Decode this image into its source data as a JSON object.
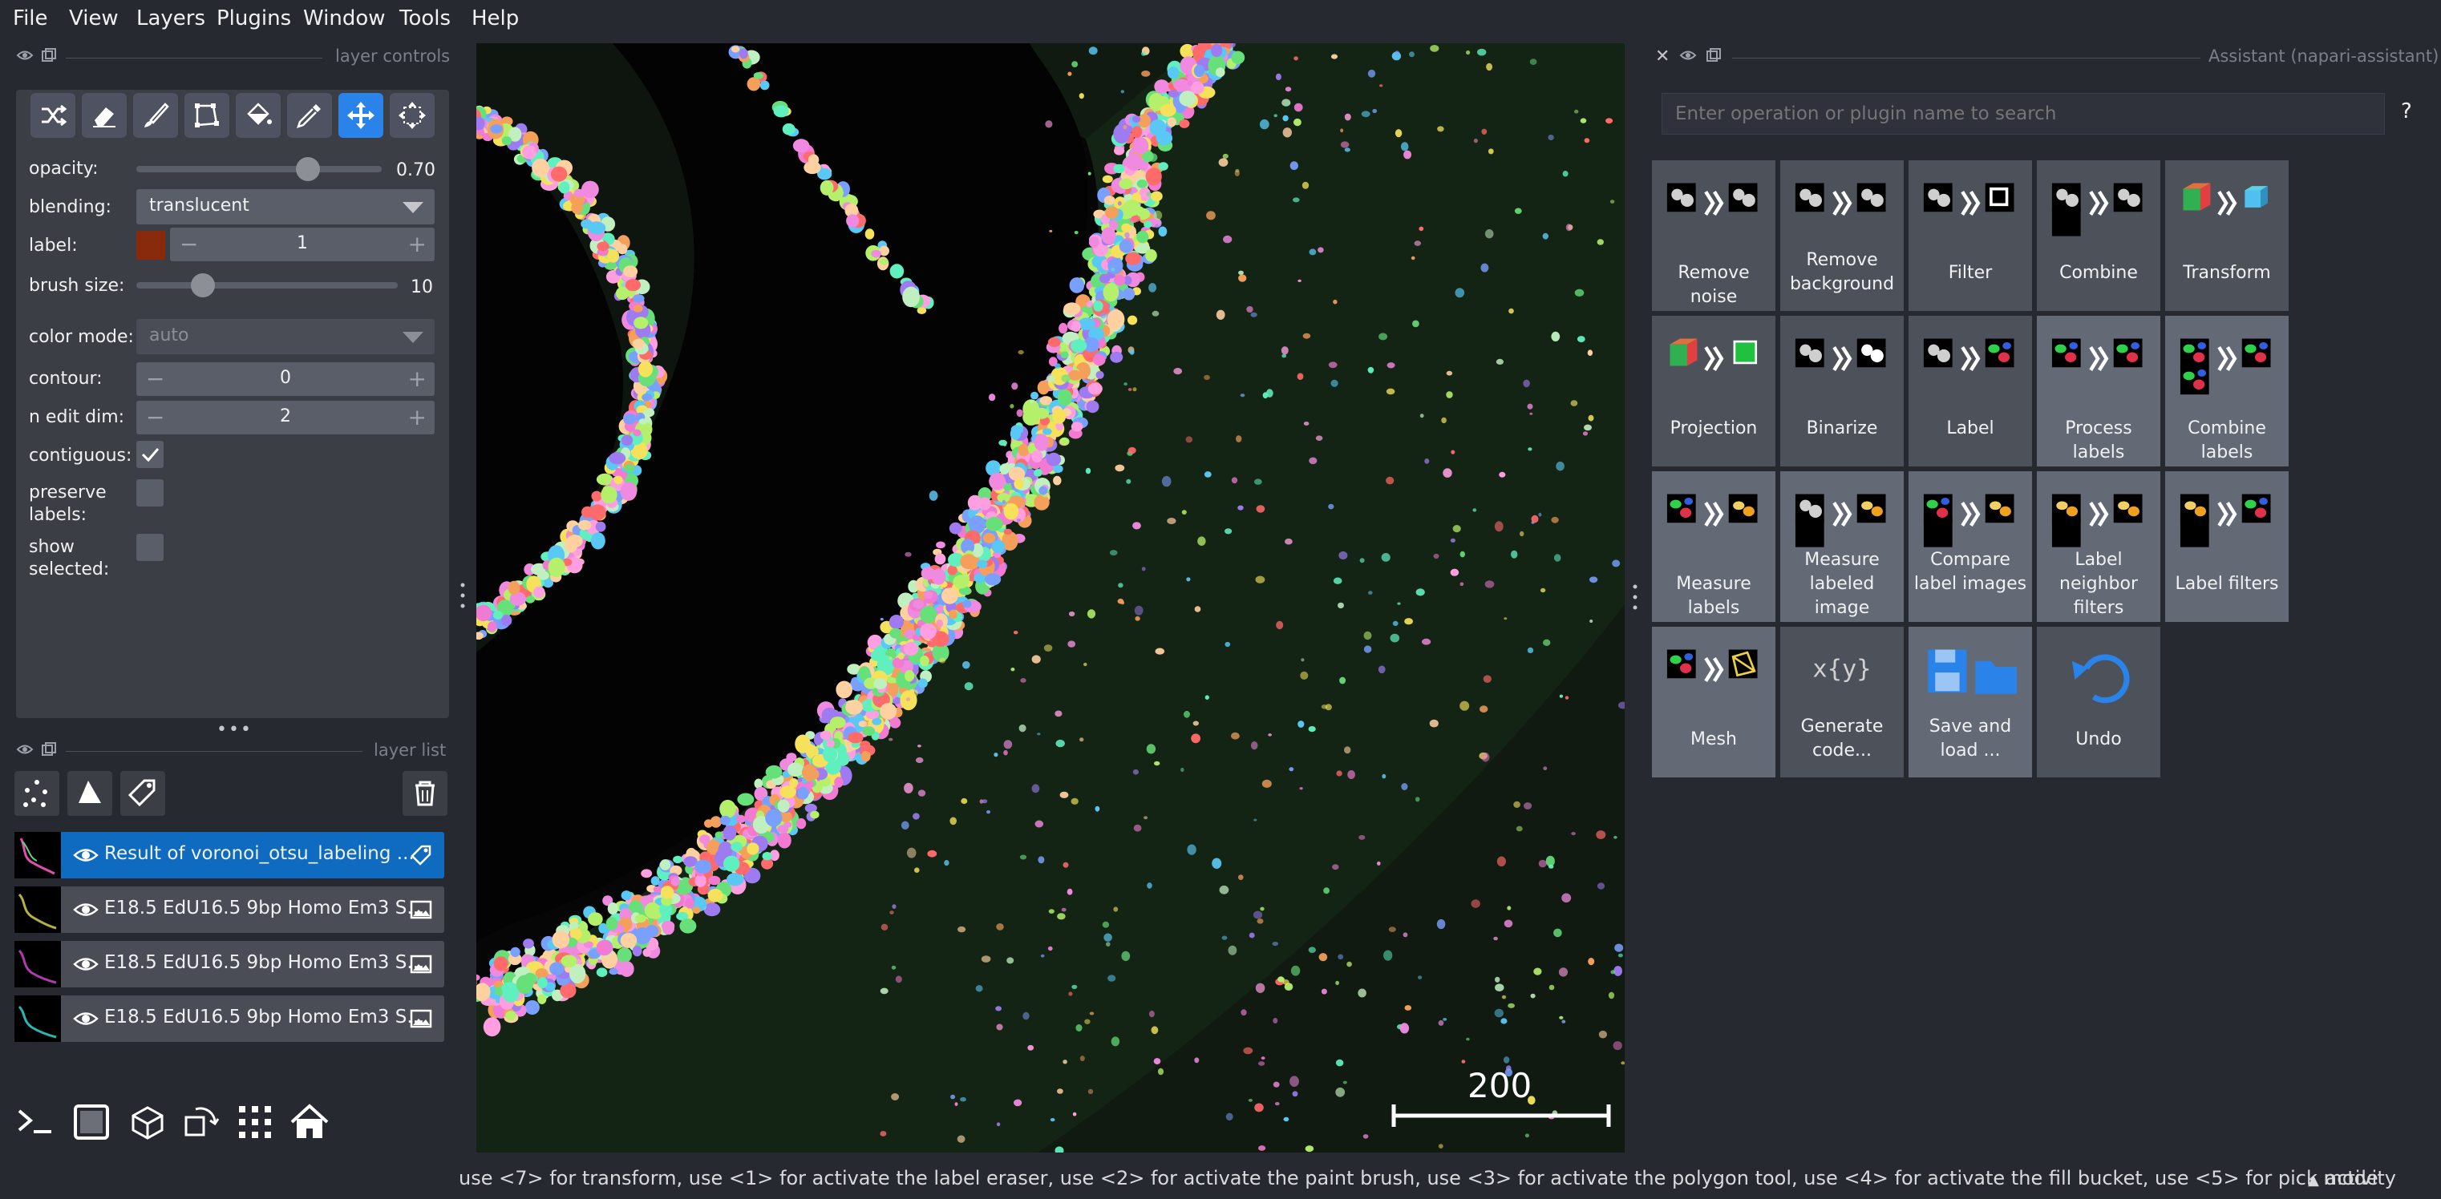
{
  "menu": [
    "File",
    "View",
    "Layers",
    "Plugins",
    "Window",
    "Tools",
    "Help"
  ],
  "layer_controls": {
    "title": "layer controls",
    "opacity_label": "opacity:",
    "opacity_value": "0.70",
    "opacity_fraction": 0.7,
    "blending_label": "blending:",
    "blending_value": "translucent",
    "label_label": "label:",
    "label_value": "1",
    "label_color": "#8a2a0c",
    "brush_size_label": "brush size:",
    "brush_size_value": "10",
    "color_mode_label": "color mode:",
    "color_mode_value": "auto",
    "contour_label": "contour:",
    "contour_value": "0",
    "n_edit_dim_label": "n edit dim:",
    "n_edit_dim_value": "2",
    "contiguous_label": "contiguous:",
    "contiguous_checked": true,
    "preserve_labels_label_1": "preserve",
    "preserve_labels_label_2": "labels:",
    "preserve_labels_checked": false,
    "show_selected_label_1": "show",
    "show_selected_label_2": "selected:",
    "show_selected_checked": false,
    "tools": [
      "shuffle-colors",
      "eraser",
      "paint-brush",
      "polygon",
      "fill-bucket",
      "color-picker",
      "transform",
      "pan-zoom"
    ],
    "active_tool": "transform"
  },
  "layer_list": {
    "title": "layer list",
    "layers": [
      {
        "name": "Result of voronoi_otsu_labeling ...",
        "type": "labels",
        "selected": true
      },
      {
        "name": "E18.5 EdU16.5 9bp Homo Em3 S...",
        "type": "image",
        "selected": false
      },
      {
        "name": "E18.5 EdU16.5 9bp Homo Em3 S...",
        "type": "image",
        "selected": false
      },
      {
        "name": "E18.5 EdU16.5 9bp Homo Em3 S...",
        "type": "image",
        "selected": false
      }
    ]
  },
  "canvas": {
    "scale_bar_label": "200"
  },
  "assistant": {
    "title": "Assistant (napari-assistant)",
    "search_placeholder": "Enter operation or plugin name to search",
    "help_label": "?",
    "tiles": [
      {
        "label": "Remove noise",
        "highlight": false
      },
      {
        "label": "Remove background",
        "highlight": false
      },
      {
        "label": "Filter",
        "highlight": false
      },
      {
        "label": "Combine",
        "highlight": false
      },
      {
        "label": "Transform",
        "highlight": false
      },
      {
        "label": "Projection",
        "highlight": false
      },
      {
        "label": "Binarize",
        "highlight": false
      },
      {
        "label": "Label",
        "highlight": false
      },
      {
        "label": "Process labels",
        "highlight": true
      },
      {
        "label": "Combine labels",
        "highlight": true
      },
      {
        "label": "Measure labels",
        "highlight": true
      },
      {
        "label": "Measure labeled image",
        "highlight": true
      },
      {
        "label": "Compare label images",
        "highlight": true
      },
      {
        "label": "Label neighbor filters",
        "highlight": true
      },
      {
        "label": "Label filters",
        "highlight": true
      },
      {
        "label": "Mesh",
        "highlight": true
      },
      {
        "label": "Generate code...",
        "highlight": false
      },
      {
        "label": "Save and load ...",
        "highlight": true
      },
      {
        "label": "Undo",
        "highlight": false
      }
    ]
  },
  "status_bar": {
    "message": "use <7> for transform, use <1> for activate the label eraser, use <2> for activate the paint brush, use <3> for activate the polygon tool, use <4> for activate the fill bucket, use <5> for pick mode",
    "activity_label": "activity"
  },
  "colors": {
    "background": "#262930",
    "panel": "#3b3e45",
    "accent": "#2a83e8",
    "selected_layer": "#0e6bc0"
  }
}
